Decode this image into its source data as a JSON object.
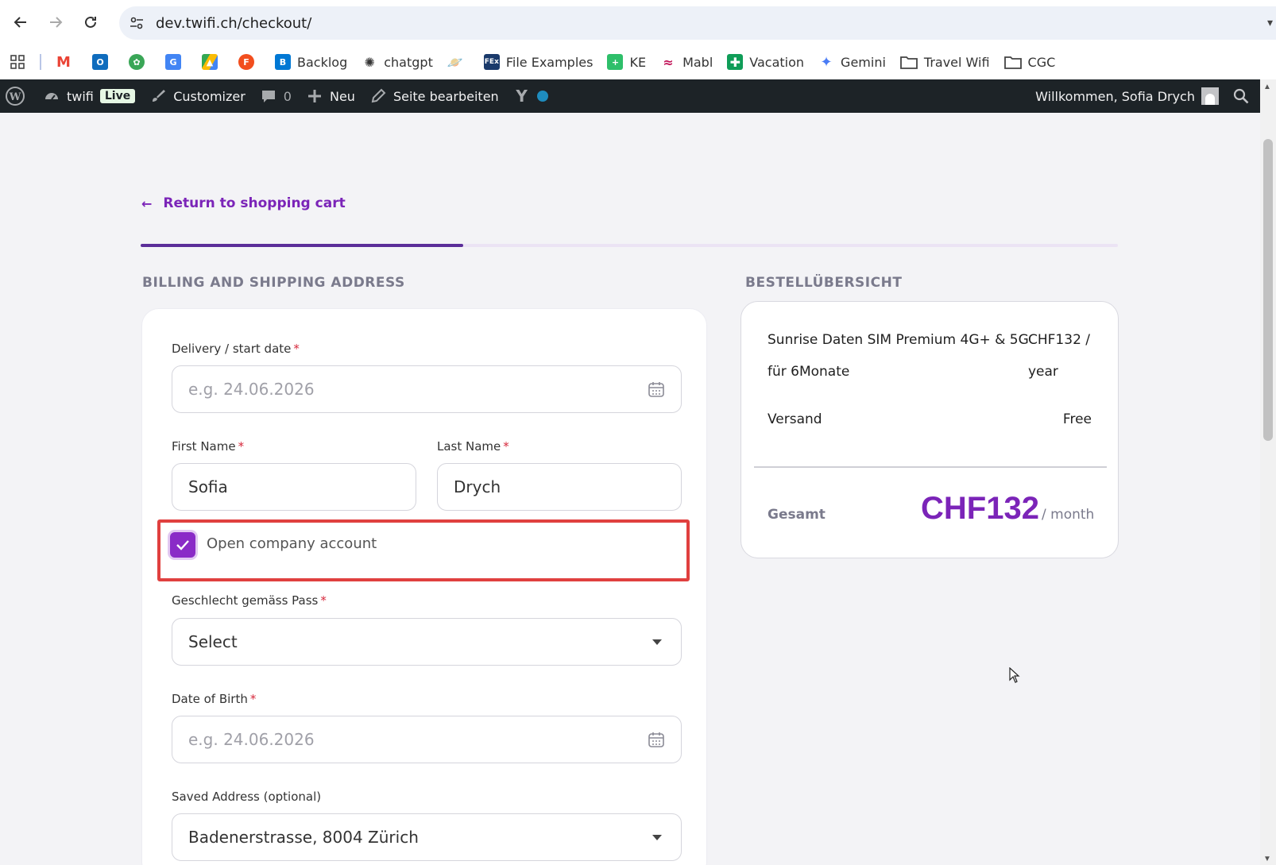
{
  "browser": {
    "url": "dev.twifi.ch/checkout/",
    "bookmarks": [
      {
        "label": "",
        "icon": "apps-grid-icon"
      },
      {
        "label": "",
        "icon": "gmail-icon"
      },
      {
        "label": "",
        "icon": "outlook-icon"
      },
      {
        "label": "",
        "icon": "frog-icon"
      },
      {
        "label": "",
        "icon": "google-translate-icon"
      },
      {
        "label": "",
        "icon": "google-drive-icon"
      },
      {
        "label": "",
        "icon": "figma-icon"
      },
      {
        "label": "Backlog",
        "icon": "backlog-icon"
      },
      {
        "label": "chatgpt",
        "icon": "chatgpt-icon"
      },
      {
        "label": "",
        "icon": "planet-icon"
      },
      {
        "label": "File Examples",
        "icon": "file-examples-icon"
      },
      {
        "label": "KE",
        "icon": "ke-icon"
      },
      {
        "label": "Mabl",
        "icon": "mabl-icon"
      },
      {
        "label": "Vacation",
        "icon": "sheets-icon"
      },
      {
        "label": "Gemini",
        "icon": "gemini-icon"
      },
      {
        "label": "Travel Wifi",
        "icon": "folder-icon"
      },
      {
        "label": "CGC",
        "icon": "folder-icon"
      }
    ]
  },
  "wpbar": {
    "site": "twifi",
    "live": "Live",
    "customizer": "Customizer",
    "comments": "0",
    "new": "Neu",
    "edit": "Seite bearbeiten",
    "welcome": "Willkommen, Sofia Drych"
  },
  "page": {
    "return_link": "Return to shopping cart",
    "progress_fraction": 0.33,
    "billing_title": "BILLING AND SHIPPING ADDRESS",
    "summary_title": "BESTELLÜBERSICHT"
  },
  "form": {
    "delivery_label": "Delivery / start date",
    "delivery_placeholder": "e.g. 24.06.2026",
    "first_name_label": "First Name",
    "first_name_value": "Sofia",
    "last_name_label": "Last Name",
    "last_name_value": "Drych",
    "company_label": "Open company account",
    "company_checked": true,
    "gender_label": "Geschlecht gemäss Pass",
    "gender_value": "Select",
    "dob_label": "Date of Birth",
    "dob_placeholder": "e.g. 24.06.2026",
    "saved_address_label": "Saved Address (optional)",
    "saved_address_value": "Badenerstrasse, 8004 Zürich",
    "required_mark": "*"
  },
  "summary": {
    "product_line1": "Sunrise Daten SIM Premium 4G+ & 5G",
    "product_line2": "für 6Monate",
    "product_price_line1": "CHF132 /",
    "product_price_line2": "year",
    "shipping_label": "Versand",
    "shipping_value": "Free",
    "total_label": "Gesamt",
    "total_price": "CHF132",
    "total_unit": "/ month"
  },
  "colors": {
    "accent": "#7b24b8",
    "wpbar": "#1d2327",
    "highlight": "#e0403f"
  }
}
